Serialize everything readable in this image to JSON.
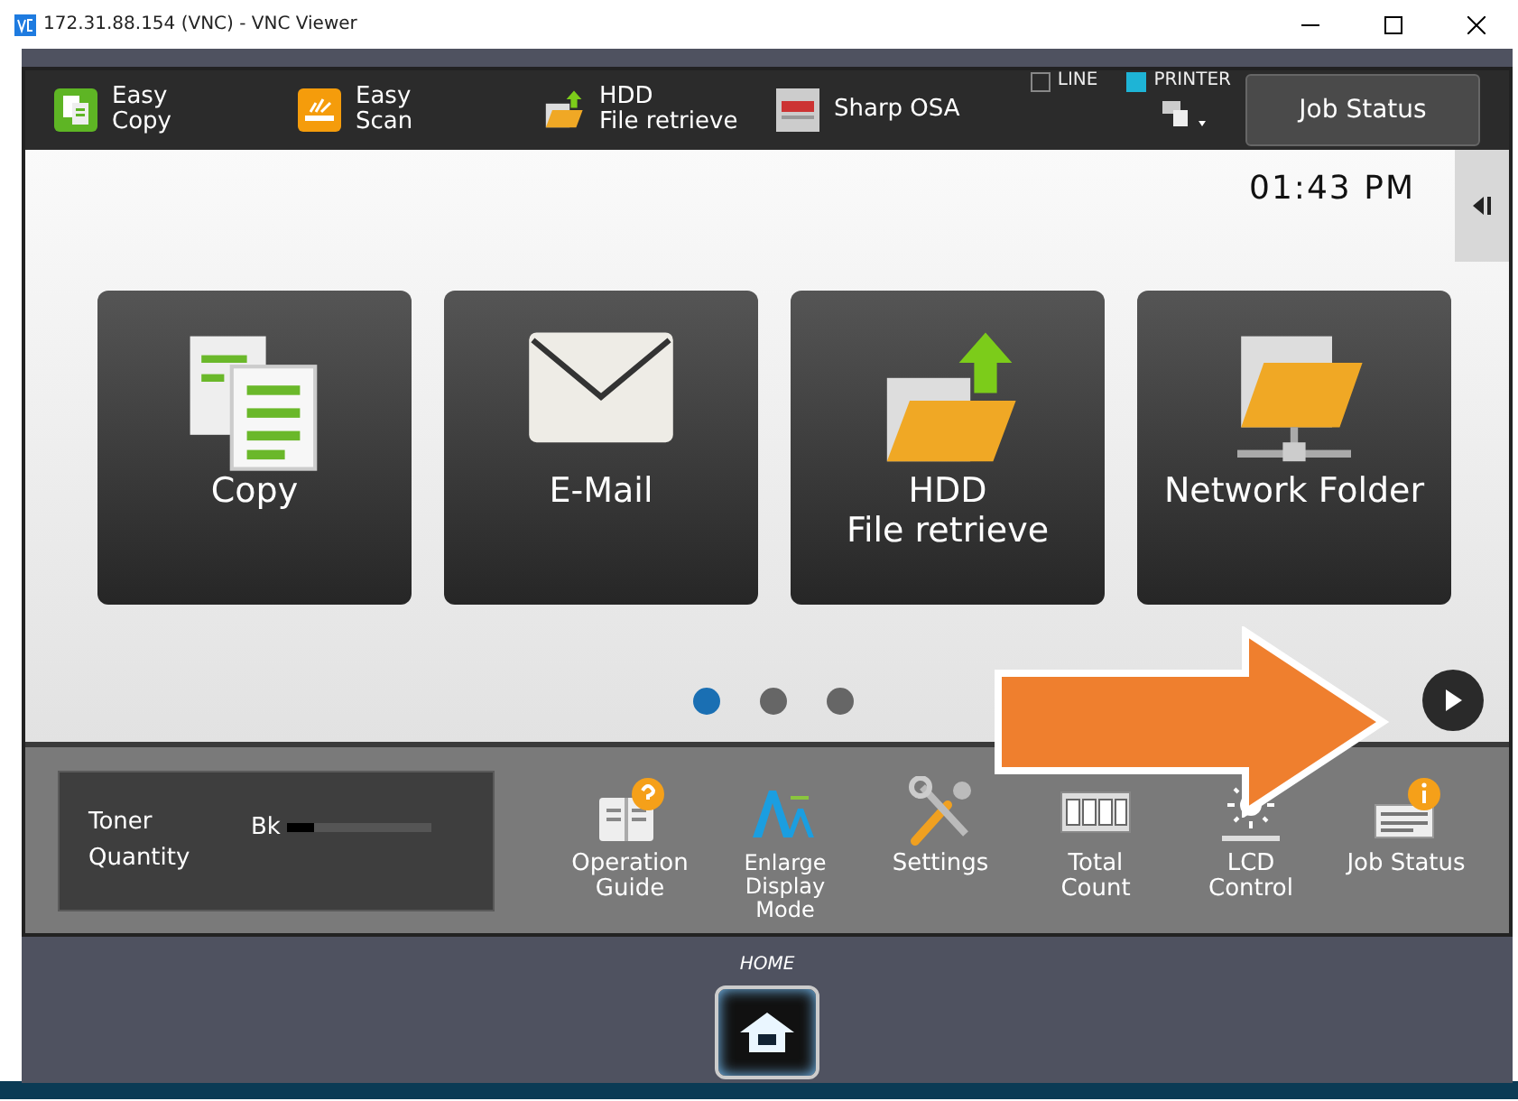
{
  "window": {
    "title": "172.31.88.154 (VNC) - VNC Viewer"
  },
  "top_bar": {
    "shortcuts": [
      {
        "kind": "copy",
        "lines": [
          "Easy",
          "Copy"
        ]
      },
      {
        "kind": "scan",
        "lines": [
          "Easy",
          "Scan"
        ]
      },
      {
        "kind": "hdd",
        "lines": [
          "HDD",
          "File retrieve"
        ]
      },
      {
        "kind": "osa",
        "lines": [
          "Sharp OSA"
        ]
      }
    ],
    "indicators": [
      {
        "label": "LINE",
        "on": false
      },
      {
        "label": "PRINTER",
        "on": true
      }
    ],
    "job_status": "Job Status"
  },
  "clock": "01:43 PM",
  "tiles": [
    {
      "kind": "copy",
      "lines": [
        "Copy"
      ]
    },
    {
      "kind": "mail",
      "lines": [
        "E-Mail"
      ]
    },
    {
      "kind": "hdd",
      "lines": [
        "HDD",
        "File retrieve"
      ]
    },
    {
      "kind": "network",
      "lines": [
        "Network Folder"
      ]
    }
  ],
  "pages": [
    {
      "selected": true
    },
    {
      "selected": false
    },
    {
      "selected": false
    }
  ],
  "toner": {
    "label_lines": [
      "Toner",
      "Quantity"
    ],
    "channel": "Bk",
    "level": 0.18
  },
  "tools": [
    {
      "kind": "guide",
      "lines": [
        "Operation",
        "Guide"
      ]
    },
    {
      "kind": "enlarge",
      "lines": [
        "Enlarge",
        "Display",
        "Mode"
      ]
    },
    {
      "kind": "settings",
      "lines": [
        "Settings"
      ]
    },
    {
      "kind": "count",
      "lines": [
        "Total",
        "Count"
      ]
    },
    {
      "kind": "lcd",
      "lines": [
        "LCD",
        "Control"
      ]
    },
    {
      "kind": "job",
      "lines": [
        "Job Status"
      ]
    }
  ],
  "home": {
    "label": "HOME"
  }
}
